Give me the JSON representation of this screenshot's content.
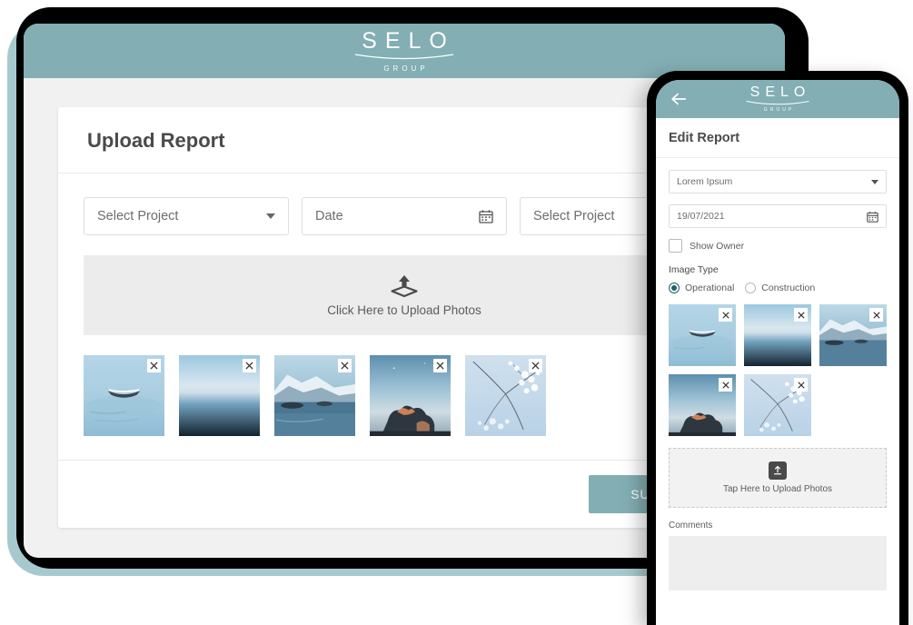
{
  "brand": {
    "name": "SELO",
    "sub": "GROUP",
    "teal": "#82AEB4",
    "accent_dark": "#1E5F6C"
  },
  "tablet": {
    "page_title": "Upload Report",
    "fields": [
      {
        "label": "Select Project",
        "icon": "chevron-down-icon"
      },
      {
        "label": "Date",
        "icon": "calendar-icon"
      },
      {
        "label": "Select Project",
        "icon": "none"
      }
    ],
    "dropzone": {
      "label": "Click Here to Upload Photos",
      "icon": "upload-icon"
    },
    "thumbnails": [
      {
        "alt": "boat-on-misty-water",
        "remove_label": "×"
      },
      {
        "alt": "blue-sea-horizon",
        "remove_label": "×"
      },
      {
        "alt": "snowy-fjord-mountain",
        "remove_label": "×"
      },
      {
        "alt": "sunset-clouds",
        "remove_label": "×"
      },
      {
        "alt": "white-blossom-branches",
        "remove_label": "×"
      }
    ],
    "submit_label": "SUBMIT"
  },
  "phone": {
    "back_icon": "back-arrow-icon",
    "page_title": "Edit Report",
    "project_value": "Lorem Ipsum",
    "date_value": "19/07/2021",
    "checkbox": {
      "label": "Show Owner",
      "checked": false
    },
    "image_type": {
      "label": "Image Type",
      "options": [
        {
          "label": "Operational",
          "selected": true
        },
        {
          "label": "Construction",
          "selected": false
        }
      ]
    },
    "thumbnails": [
      {
        "alt": "boat-on-misty-water",
        "remove_label": "×"
      },
      {
        "alt": "blue-sea-horizon",
        "remove_label": "×"
      },
      {
        "alt": "snowy-fjord-mountain",
        "remove_label": "×"
      },
      {
        "alt": "sunset-clouds",
        "remove_label": "×"
      },
      {
        "alt": "white-blossom-branches",
        "remove_label": "×"
      }
    ],
    "dropzone": {
      "label": "Tap Here to Upload Photos",
      "icon": "upload-box-icon"
    },
    "comments": {
      "label": "Comments",
      "value": "",
      "placeholder": ""
    }
  }
}
